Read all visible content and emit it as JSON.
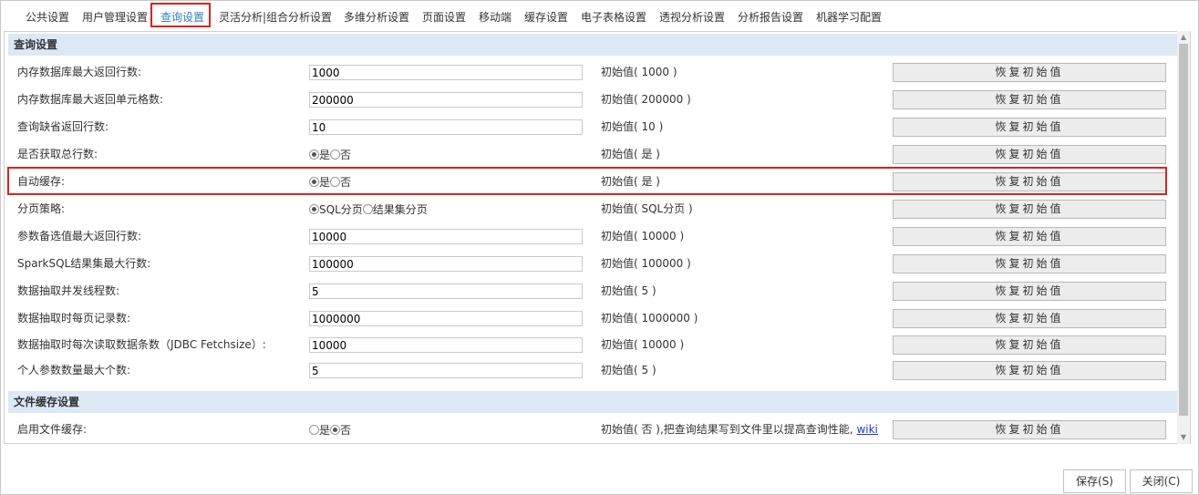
{
  "tabs": [
    {
      "label": "公共设置"
    },
    {
      "label": "用户管理设置"
    },
    {
      "label": "查询设置"
    },
    {
      "label": "灵活分析|组合分析设置"
    },
    {
      "label": "多维分析设置"
    },
    {
      "label": "页面设置"
    },
    {
      "label": "移动端"
    },
    {
      "label": "缓存设置"
    },
    {
      "label": "电子表格设置"
    },
    {
      "label": "透视分析设置"
    },
    {
      "label": "分析报告设置"
    },
    {
      "label": "机器学习配置"
    }
  ],
  "reset_label": "恢复初始值",
  "query_section": {
    "title": "查询设置",
    "rows": [
      {
        "label": "内存数据库最大返回行数:",
        "value": "1000",
        "initial": "初始值( 1000 )"
      },
      {
        "label": "内存数据库最大返回单元格数:",
        "value": "200000",
        "initial": "初始值( 200000 )"
      },
      {
        "label": "查询缺省返回行数:",
        "value": "10",
        "initial": "初始值( 10 )"
      },
      {
        "label": "是否获取总行数:",
        "options": [
          "是",
          "否"
        ],
        "selected": "是",
        "initial": "初始值( 是 )"
      },
      {
        "label": "自动缓存:",
        "options": [
          "是",
          "否"
        ],
        "selected": "是",
        "initial": "初始值( 是 )"
      },
      {
        "label": "分页策略:",
        "options": [
          "SQL分页",
          "结果集分页"
        ],
        "selected": "SQL分页",
        "initial": "初始值( SQL分页 )"
      },
      {
        "label": "参数备选值最大返回行数:",
        "value": "10000",
        "initial": "初始值( 10000 )"
      },
      {
        "label": "SparkSQL结果集最大行数:",
        "value": "100000",
        "initial": "初始值( 100000 )"
      },
      {
        "label": "数据抽取并发线程数:",
        "value": "5",
        "initial": "初始值( 5 )"
      },
      {
        "label": "数据抽取时每页记录数:",
        "value": "1000000",
        "initial": "初始值( 1000000 )"
      },
      {
        "label": "数据抽取时每次读取数据条数（JDBC Fetchsize）:",
        "value": "10000",
        "initial": "初始值( 10000 )"
      },
      {
        "label": "个人参数数量最大个数:",
        "value": "5",
        "initial": "初始值( 5 )"
      }
    ]
  },
  "file_cache_section": {
    "title": "文件缓存设置",
    "rows": [
      {
        "label": "启用文件缓存:",
        "options": [
          "是",
          "否"
        ],
        "selected": "否",
        "initial": "初始值( 否 ),把查询结果写到文件里以提高查询性能,",
        "link": "wiki"
      }
    ]
  },
  "footer": {
    "save_label": "保存(S)",
    "close_label": "关闭(C)"
  }
}
